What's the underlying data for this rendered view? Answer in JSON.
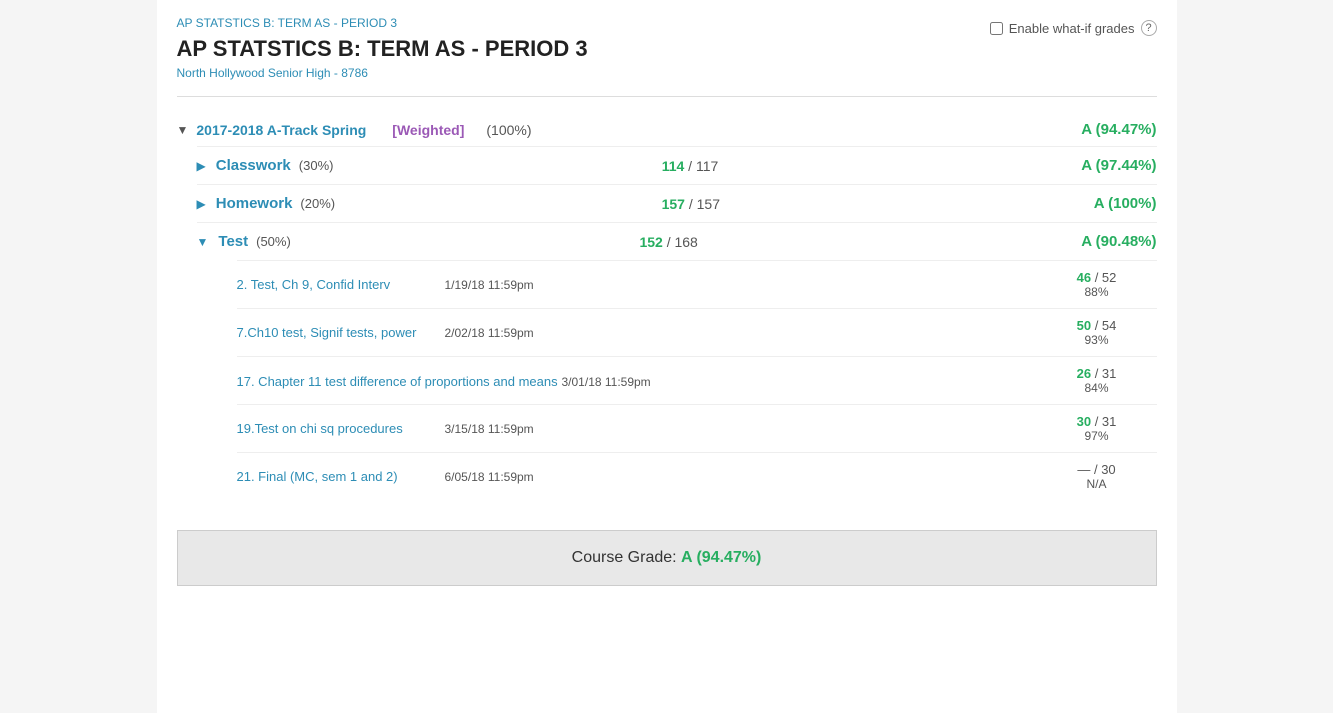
{
  "breadcrumb": "AP STATSTICS B: TERM AS - PERIOD 3",
  "title": "AP STATSTICS B: TERM AS - PERIOD 3",
  "school": "North Hollywood Senior High - 8786",
  "whatif": {
    "label": "Enable what-if grades",
    "checkbox": false
  },
  "term": {
    "toggle": "▼",
    "name": "2017-2018 A-Track Spring",
    "weighted": "[Weighted]",
    "pct": "(100%)",
    "grade": "A (94.47%)"
  },
  "categories": [
    {
      "toggle": "▶",
      "name": "Classwork",
      "weight": "(30%)",
      "numerator": "114",
      "denominator": "/ 117",
      "grade": "A (97.44%)",
      "expanded": false,
      "assignments": []
    },
    {
      "toggle": "▶",
      "name": "Homework",
      "weight": "(20%)",
      "numerator": "157",
      "denominator": "/ 157",
      "grade": "A (100%)",
      "expanded": false,
      "assignments": []
    },
    {
      "toggle": "▼",
      "name": "Test",
      "weight": "(50%)",
      "numerator": "152",
      "denominator": "/ 168",
      "grade": "A (90.48%)",
      "expanded": true,
      "assignments": [
        {
          "name": "2. Test, Ch 9, Confid Interv",
          "date": "1/19/18 11:59pm",
          "numerator": "46",
          "denominator": "/ 52",
          "pct": "88%",
          "na": false
        },
        {
          "name": "7.Ch10 test, Signif tests, power",
          "date": "2/02/18 11:59pm",
          "numerator": "50",
          "denominator": "/ 54",
          "pct": "93%",
          "na": false
        },
        {
          "name": "17. Chapter 11 test difference of proportions and means",
          "date": "3/01/18 11:59pm",
          "numerator": "26",
          "denominator": "/ 31",
          "pct": "84%",
          "na": false
        },
        {
          "name": "19.Test on chi sq procedures",
          "date": "3/15/18 11:59pm",
          "numerator": "30",
          "denominator": "/ 31",
          "pct": "97%",
          "na": false
        },
        {
          "name": "21. Final (MC, sem 1 and 2)",
          "date": "6/05/18 11:59pm",
          "numerator": "—",
          "denominator": "/ 30",
          "pct": "N/A",
          "na": true
        }
      ]
    }
  ],
  "courseGrade": {
    "label": "Course Grade:",
    "value": "A (94.47%)"
  }
}
